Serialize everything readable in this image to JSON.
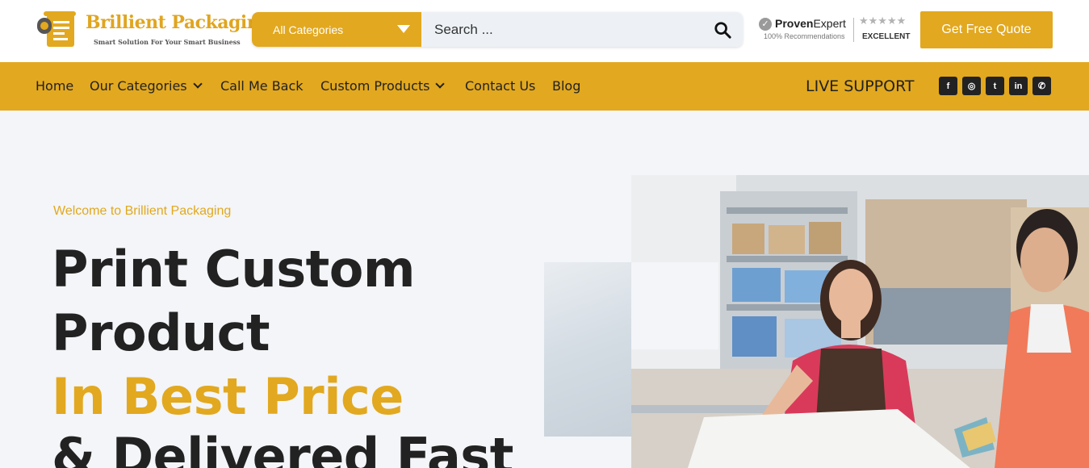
{
  "brand": {
    "name": "Brillient Packaging",
    "tagline": "Smart Solution For Your Smart Business"
  },
  "search": {
    "category_label": "All Categories",
    "placeholder": "Search ..."
  },
  "proven_expert": {
    "title_bold": "Proven",
    "title_rest": "Expert",
    "recommendations": "100% Recommendations",
    "rating_label": "EXCELLENT",
    "stars": 5
  },
  "header": {
    "quote_button": "Get Free Quote"
  },
  "nav": {
    "items": [
      {
        "label": "Home",
        "has_dropdown": false
      },
      {
        "label": "Our Categories",
        "has_dropdown": true
      },
      {
        "label": "Call Me Back",
        "has_dropdown": false
      },
      {
        "label": "Custom Products",
        "has_dropdown": true
      },
      {
        "label": "Contact Us",
        "has_dropdown": false
      },
      {
        "label": "Blog",
        "has_dropdown": false
      }
    ],
    "live_support": "LIVE SUPPORT",
    "social": [
      {
        "icon": "facebook-icon",
        "glyph": "f"
      },
      {
        "icon": "instagram-icon",
        "glyph": "◎"
      },
      {
        "icon": "twitter-icon",
        "glyph": "t"
      },
      {
        "icon": "linkedin-icon",
        "glyph": "in"
      },
      {
        "icon": "whatsapp-icon",
        "glyph": "✆"
      }
    ]
  },
  "hero": {
    "eyebrow": "Welcome to Brillient Packaging",
    "line1": "Print Custom",
    "line2": "Product",
    "line3": "In Best Price",
    "line4": "& Delivered Fast"
  },
  "colors": {
    "accent": "#e2a81f",
    "dark": "#222222",
    "background": "#f3f5f8"
  }
}
